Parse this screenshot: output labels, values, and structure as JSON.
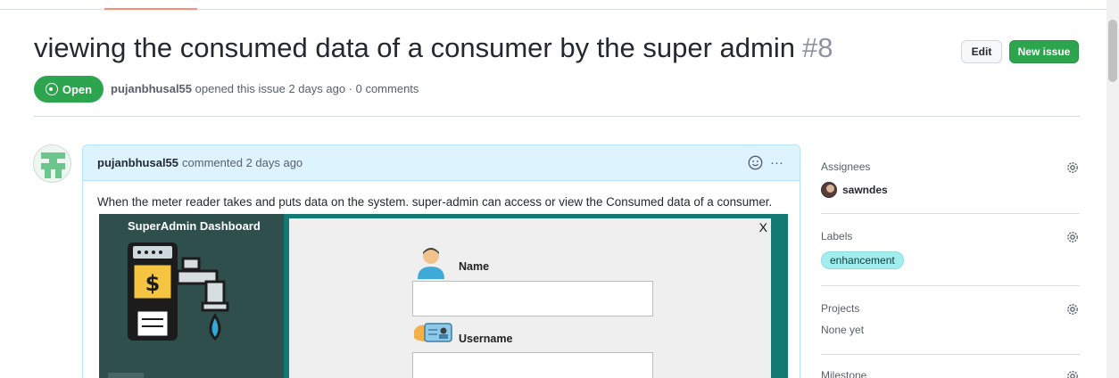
{
  "issue": {
    "title": "viewing the consumed data of a consumer by the super admin",
    "number": "#8",
    "state": "Open",
    "author": "pujanbhusal55",
    "meta_text": "opened this issue 2 days ago · 0 comments"
  },
  "actions": {
    "edit_label": "Edit",
    "new_issue_label": "New issue"
  },
  "comment": {
    "author": "pujanbhusal55",
    "header_text": "commented 2 days ago",
    "body": "When the meter reader takes and puts data on the system. super-admin can access or view the Consumed data of a consumer.",
    "more_label": "···"
  },
  "embedded_screenshot": {
    "dashboard_title": "SuperAdmin Dashboard",
    "close_label": "X",
    "dollar_symbol": "$",
    "fields": [
      {
        "label": "Name"
      },
      {
        "label": "Username"
      }
    ]
  },
  "sidebar": {
    "assignees": {
      "heading": "Assignees",
      "value": "sawndes"
    },
    "labels": {
      "heading": "Labels",
      "value": "enhancement"
    },
    "projects": {
      "heading": "Projects",
      "value": "None yet"
    },
    "milestone": {
      "heading": "Milestone"
    }
  },
  "colors": {
    "open_green": "#2da44e",
    "comment_header_blue": "#ddf4ff",
    "label_enhancement": "#a2eeef",
    "dashboard_dark": "#2f4f4d",
    "dashboard_teal": "#127a73"
  }
}
